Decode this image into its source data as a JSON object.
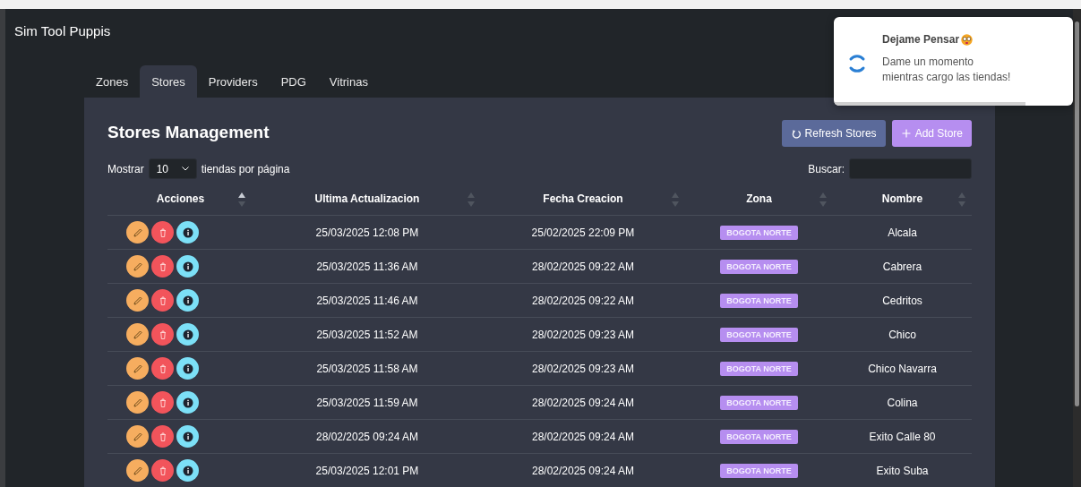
{
  "app": {
    "title": "Sim Tool Puppis"
  },
  "tabs": [
    {
      "label": "Zones",
      "selected": false
    },
    {
      "label": "Stores",
      "selected": true
    },
    {
      "label": "Providers",
      "selected": false
    },
    {
      "label": "PDG",
      "selected": false
    },
    {
      "label": "Vitrinas",
      "selected": false
    }
  ],
  "panel": {
    "title": "Stores Management",
    "buttons": [
      {
        "kind": "refresh",
        "label": "Refresh Stores"
      },
      {
        "kind": "add",
        "label": "Add Store"
      }
    ],
    "page_size": {
      "prefix": "Mostrar",
      "value": "10",
      "suffix": "tiendas por página"
    },
    "search": {
      "label": "Buscar:"
    }
  },
  "table": {
    "columns": [
      {
        "label": "Acciones",
        "sorted": true
      },
      {
        "label": "Ultima Actualizacion",
        "sorted": false
      },
      {
        "label": "Fecha Creacion",
        "sorted": false
      },
      {
        "label": "Zona",
        "sorted": false
      },
      {
        "label": "Nombre",
        "sorted": false
      }
    ],
    "rows": [
      {
        "updated": "25/03/2025 12:08 PM",
        "created": "25/02/2025 22:09 PM",
        "zone": "BOGOTA NORTE",
        "name": "Alcala"
      },
      {
        "updated": "25/03/2025 11:36 AM",
        "created": "28/02/2025 09:22 AM",
        "zone": "BOGOTA NORTE",
        "name": "Cabrera"
      },
      {
        "updated": "25/03/2025 11:46 AM",
        "created": "28/02/2025 09:22 AM",
        "zone": "BOGOTA NORTE",
        "name": "Cedritos"
      },
      {
        "updated": "25/03/2025 11:52 AM",
        "created": "28/02/2025 09:23 AM",
        "zone": "BOGOTA NORTE",
        "name": "Chico"
      },
      {
        "updated": "25/03/2025 11:58 AM",
        "created": "28/02/2025 09:23 AM",
        "zone": "BOGOTA NORTE",
        "name": "Chico Navarra"
      },
      {
        "updated": "25/03/2025 11:59 AM",
        "created": "28/02/2025 09:24 AM",
        "zone": "BOGOTA NORTE",
        "name": "Colina"
      },
      {
        "updated": "28/02/2025 09:24 AM",
        "created": "28/02/2025 09:24 AM",
        "zone": "BOGOTA NORTE",
        "name": "Exito Calle 80"
      },
      {
        "updated": "25/03/2025 12:01 PM",
        "created": "28/02/2025 09:24 AM",
        "zone": "BOGOTA NORTE",
        "name": "Exito Suba"
      }
    ]
  },
  "toast": {
    "title": "Dejame Pensar",
    "message": "Dame un momento mientras cargo las tiendas!",
    "level": 0.8
  }
}
